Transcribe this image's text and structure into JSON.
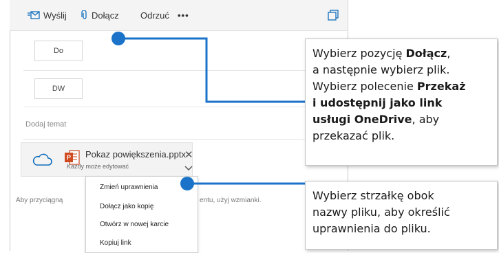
{
  "toolbar": {
    "send_label": "Wyślij",
    "attach_label": "Dołącz",
    "discard_label": "Odrzuć",
    "more_label": "•••"
  },
  "fields": {
    "to_label": "Do",
    "cc_label": "DW",
    "subject_placeholder": "Dodaj temat"
  },
  "attachment": {
    "file_name": "Pokaz powiększenia.pptx",
    "permission": "Każdy może edytować"
  },
  "body": {
    "hint_left": "Aby przyciągną",
    "hint_right": "entu, użyj wzmianki."
  },
  "menu": {
    "items": [
      "Zmień uprawnienia",
      "Dołącz jako kopię",
      "Otwórz w nowej karcie",
      "Kopiuj link"
    ]
  },
  "callouts": {
    "attach": {
      "t1": "Wybierz pozycję ",
      "b1": "Dołącz",
      "t2": ",",
      "t3": "a następnie wybierz plik.",
      "t4": "Wybierz polecenie ",
      "b2": "Przekaż",
      "b3": "i udostępnij jako link",
      "b4": "usługi OneDrive",
      "t5": ", aby",
      "t6": "przekazać plik."
    },
    "arrow": {
      "l1": "Wybierz strzałkę obok",
      "l2": "nazwy pliku, aby określić",
      "l3": "uprawnienia do pliku."
    }
  },
  "colors": {
    "accent": "#0f6cbd",
    "marker": "#1a73c8"
  }
}
